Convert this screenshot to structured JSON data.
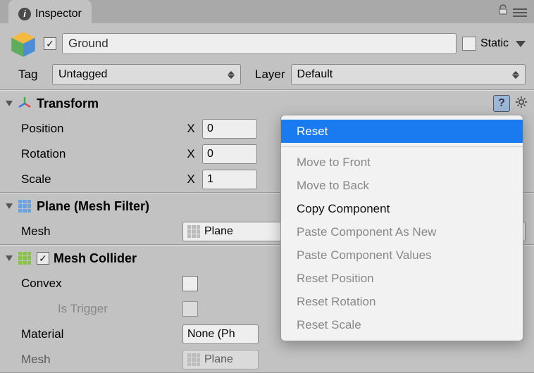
{
  "inspector": {
    "tab_title": "Inspector"
  },
  "header": {
    "name": "Ground",
    "active": true,
    "static_label": "Static",
    "static_checked": false,
    "tag_label": "Tag",
    "tag_value": "Untagged",
    "layer_label": "Layer",
    "layer_value": "Default"
  },
  "transform": {
    "title": "Transform",
    "position_label": "Position",
    "rotation_label": "Rotation",
    "scale_label": "Scale",
    "axis_x": "X",
    "pos_x": "0",
    "rot_x": "0",
    "scale_x": "1"
  },
  "meshfilter": {
    "title": "Plane (Mesh Filter)",
    "mesh_label": "Mesh",
    "mesh_value": "Plane"
  },
  "meshcollider": {
    "title": "Mesh Collider",
    "convex_label": "Convex",
    "istrigger_label": "Is Trigger",
    "material_label": "Material",
    "material_value": "None (Ph",
    "mesh_label": "Mesh",
    "mesh_value": "Plane"
  },
  "context_menu": {
    "reset": "Reset",
    "move_front": "Move to Front",
    "move_back": "Move to Back",
    "copy": "Copy Component",
    "paste_new": "Paste Component As New",
    "paste_values": "Paste Component Values",
    "reset_pos": "Reset Position",
    "reset_rot": "Reset Rotation",
    "reset_scale": "Reset Scale"
  }
}
